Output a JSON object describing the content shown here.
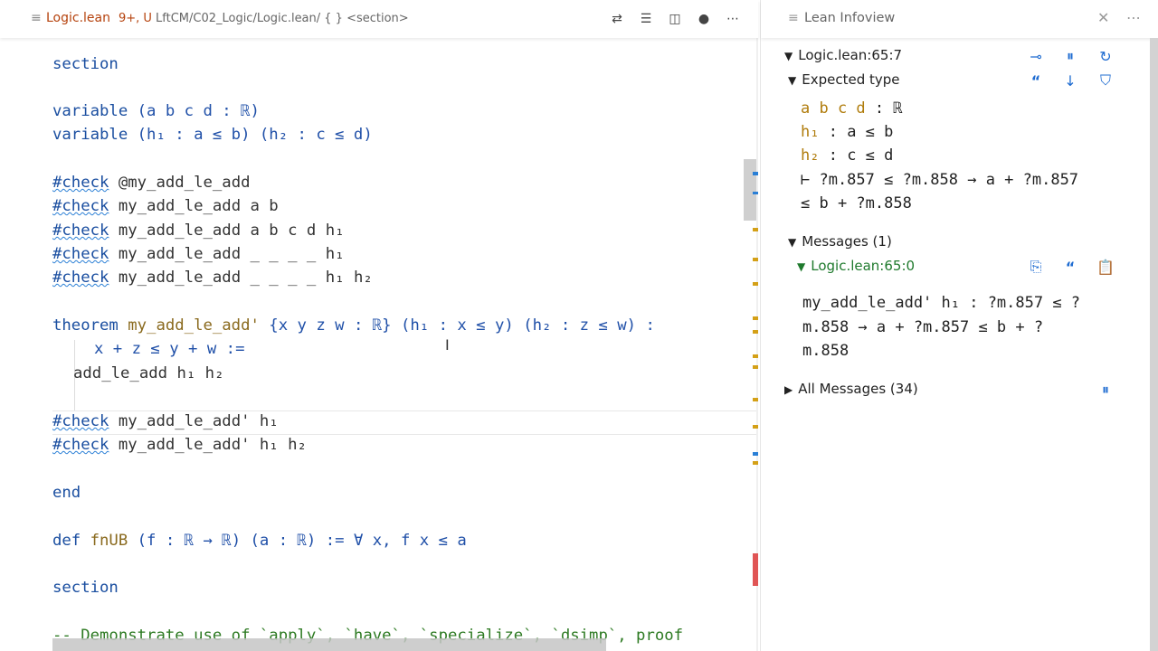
{
  "tab": {
    "filename": "Logic.lean",
    "problems": "9+, U",
    "breadcrumb": "LftCM/C02_Logic/Logic.lean/ { } <section>"
  },
  "code": {
    "l1": "section",
    "l2a": "variable ",
    "l2b": "(a b c d : ℝ)",
    "l3a": "variable ",
    "l3b": "(h₁ : a ≤ b) (h₂ : c ≤ d)",
    "c1": "#check",
    " c1r": "",
    "r1": " @my_add_le_add",
    "r2": " my_add_le_add a b",
    "r3": " my_add_le_add a b c d h₁",
    "r4": " my_add_le_add _ _ _ _ h₁",
    "r5": " my_add_le_add _ _ _ _ h₁ h₂",
    "t1": "theorem ",
    "t2": "my_add_le_add'",
    "t3": " {x y z w : ℝ} (h₁ : x ≤ y) (h₂ : z ≤ w) :",
    "t4": "x + z ≤ y + w :=",
    "t5": "add_le_add h₁ h₂",
    "r6": " my_add_le_add' h₁",
    "r7": " my_add_le_add' h₁ h₂",
    "end": "end",
    "d1": "def ",
    "d2": "fnUB",
    "d3": " (f : ℝ → ℝ) (a : ℝ) := ∀ x, f x ≤ a",
    "s2": "section",
    "cm": "-- Demonstrate use of `apply`, `have`, `specialize`, `dsimp`, proof"
  },
  "infoview": {
    "title": "Lean Infoview",
    "loc": "Logic.lean:65:7",
    "expected": "Expected type",
    "hyp1n": "a b c d",
    "hyp1t": " : ℝ",
    "hyp2n": "h₁",
    "hyp2t": " : a ≤ b",
    "hyp3n": "h₂",
    "hyp3t": " : c ≤ d",
    "goal1": "⊢ ?m.857 ≤ ?m.858 → a + ?m.857",
    "goal2": "≤ b + ?m.858",
    "messages": "Messages (1)",
    "msgloc": "Logic.lean:65:0",
    "msg1": "my_add_le_add' h₁ : ?m.857 ≤ ?",
    "msg2": "m.858 → a + ?m.857 ≤ b + ?",
    "msg3": "m.858",
    "all": "All Messages (34)"
  },
  "colors": {
    "accent": "#1f6cd1",
    "hyp": "#b07c0c",
    "keyword": "#1a4ea0"
  }
}
